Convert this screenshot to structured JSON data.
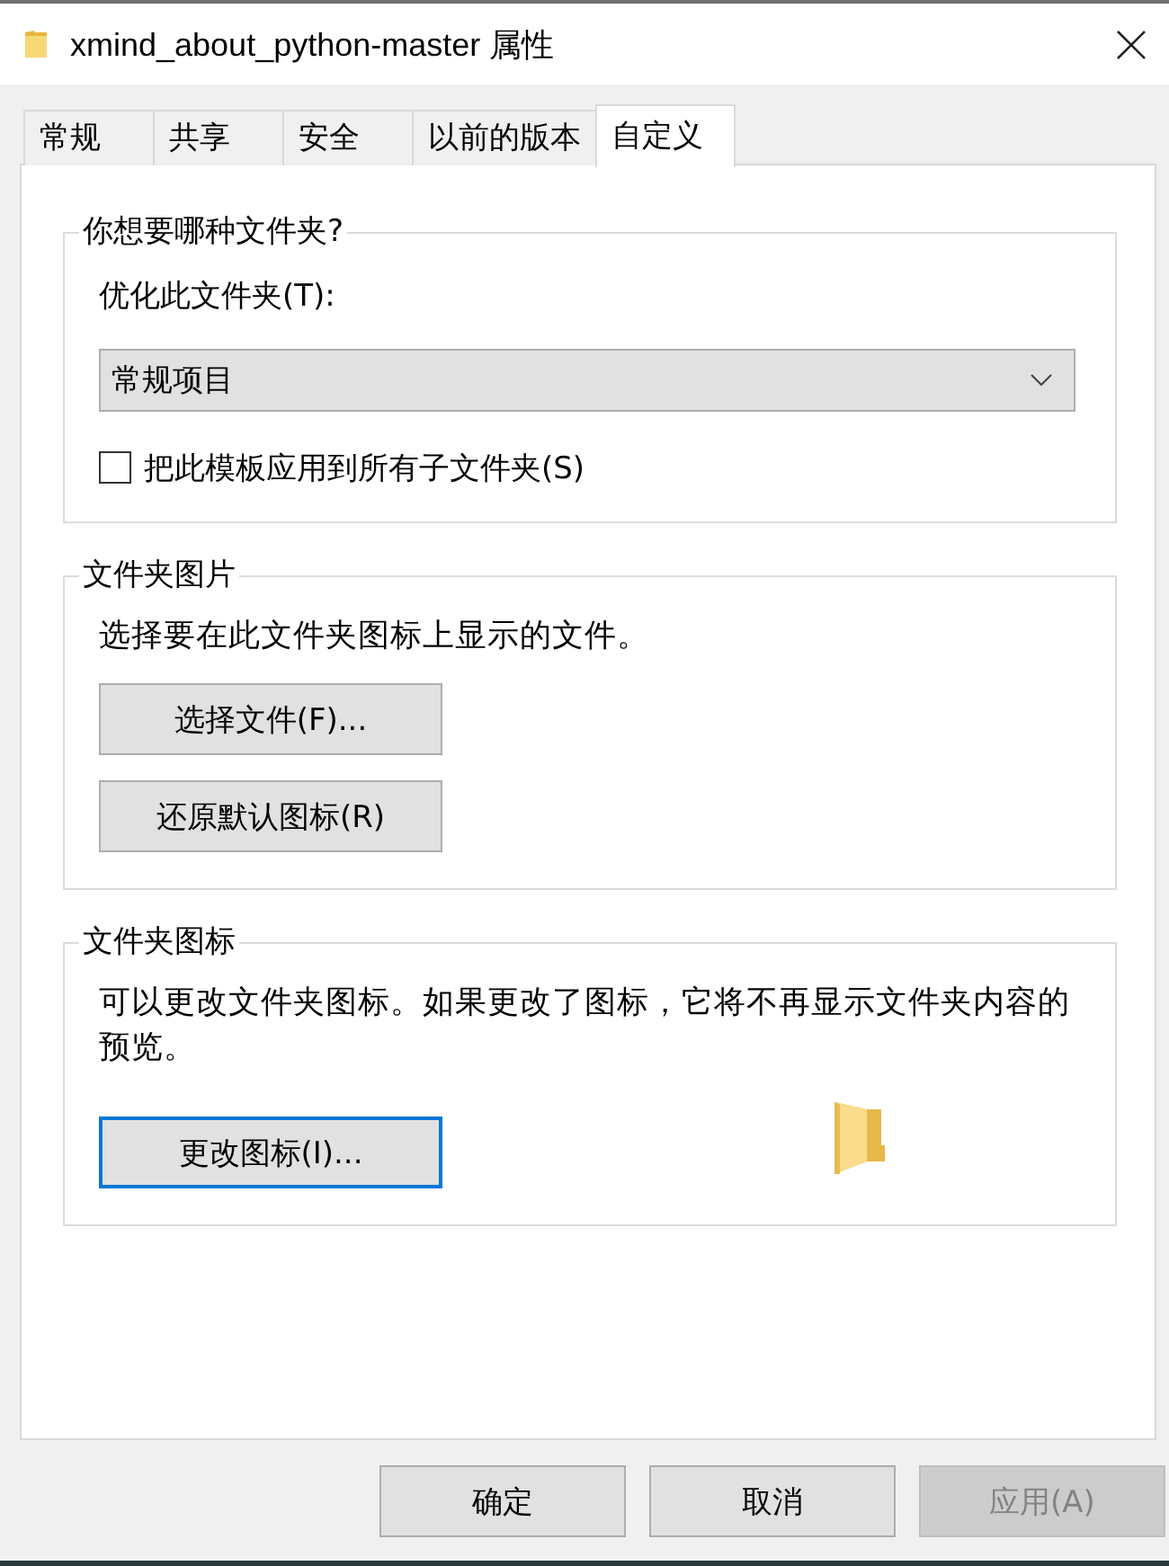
{
  "window": {
    "title": "xmind_about_python-master 属性"
  },
  "tabs": [
    {
      "label": "常规",
      "selected": false
    },
    {
      "label": "共享",
      "selected": false
    },
    {
      "label": "安全",
      "selected": false
    },
    {
      "label": "以前的版本",
      "selected": false
    },
    {
      "label": "自定义",
      "selected": true
    }
  ],
  "sections": [
    {
      "title": "你想要哪种文件夹?",
      "items": [
        {
          "kind": "label",
          "text": "优化此文件夹(T):"
        },
        {
          "kind": "dropdown",
          "value": "常规项目"
        },
        {
          "kind": "checkbox",
          "label": "把此模板应用到所有子文件夹(S)",
          "checked": false
        }
      ]
    },
    {
      "title": "文件夹图片",
      "items": [
        {
          "kind": "text",
          "text": "选择要在此文件夹图标上显示的文件。"
        },
        {
          "kind": "button",
          "label": "选择文件(F)...",
          "focused": false
        },
        {
          "kind": "button",
          "label": "还原默认图标(R)",
          "focused": false
        }
      ]
    },
    {
      "title": "文件夹图标",
      "items": [
        {
          "kind": "text",
          "text": "可以更改文件夹图标。如果更改了图标，它将不再显示文件夹内容的预览。"
        },
        {
          "kind": "button_preview",
          "label": "更改图标(I)...",
          "focused": true
        }
      ]
    }
  ],
  "buttons": [
    {
      "label": "确定",
      "disabled": false
    },
    {
      "label": "取消",
      "disabled": false
    },
    {
      "label": "应用(A)",
      "disabled": true
    }
  ]
}
